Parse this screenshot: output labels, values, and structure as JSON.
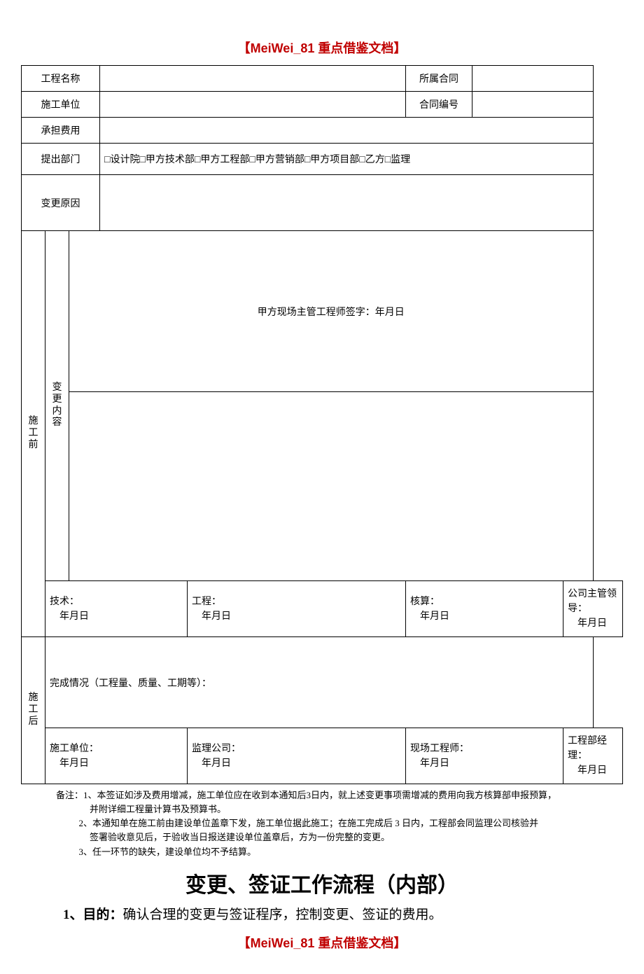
{
  "header_text": "【MeiWei_81 重点借鉴文档】",
  "footer_text": "【MeiWei_81 重点借鉴文档】",
  "labels": {
    "project_name": "工程名称",
    "contract_belong": "所属合同",
    "construction_unit": "施工单位",
    "contract_no": "合同编号",
    "bear_fee": "承担费用",
    "raise_dept": "提出部门",
    "raise_dept_options": "□设计院□甲方技术部□甲方工程部□甲方营销部□甲方项目部□乙方□监理",
    "change_reason": "变更原因",
    "pre_construct": "施\n工\n前",
    "change_content": "变\n更\n内\n容",
    "signer_text": "甲方现场主管工程师签字：年月日",
    "tech": "技术：",
    "engineer": "工程：",
    "account": "核算：",
    "leader": "公司主管领导：",
    "date_ymd": "年月日",
    "post_construct": "施\n工\n后",
    "completion_status": "完成情况（工程量、质量、工期等）：",
    "sgdw": "施工单位：",
    "jlgs": "监理公司：",
    "xcgcs": "现场工程师：",
    "gcbjl": "工程部经理："
  },
  "notes_prefix": "备注：",
  "notes": [
    "1、本签证如涉及费用增减，施工单位应在收到本通知后3日内，就上述变更事项需增减的费用向我方核算部申报预算，",
    "并附详细工程量计算书及预算书。",
    "2、本通知单在施工前由建设单位盖章下发，施工单位据此施工；在施工完成后 3 日内，工程部会同监理公司核验并",
    "签署验收意见后，于验收当日报送建设单位盖章后，方为一份完整的变更。",
    "3、任一环节的缺失，建设单位均不予结算。"
  ],
  "title2": "变更、签证工作流程（内部）",
  "goal_label": "1、目的：",
  "goal_text": "确认合理的变更与签证程序，控制变更、签证的费用。"
}
